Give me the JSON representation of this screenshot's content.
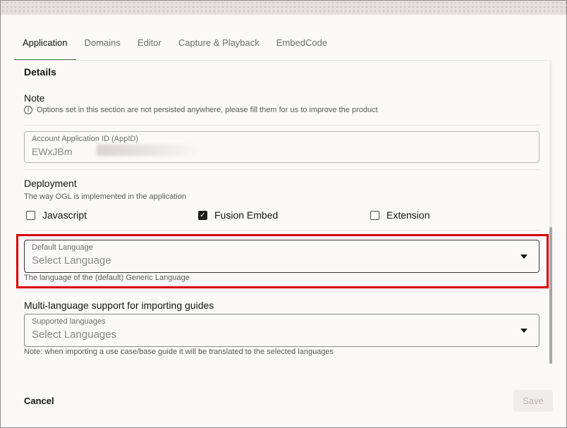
{
  "tabs": [
    {
      "label": "Application",
      "active": true
    },
    {
      "label": "Domains",
      "active": false
    },
    {
      "label": "Editor",
      "active": false
    },
    {
      "label": "Capture & Playback",
      "active": false
    },
    {
      "label": "EmbedCode",
      "active": false
    }
  ],
  "details": {
    "title": "Details",
    "note_title": "Note",
    "note_text": "Options set in this section are not persisted anywhere, please fill them for us to improve the product",
    "info_icon": "i"
  },
  "app_id": {
    "label": "Account Application ID (AppID)",
    "value": "EWxJBm"
  },
  "deployment": {
    "title": "Deployment",
    "subtitle": "The way OGL is implemented in the application",
    "options": [
      {
        "label": "Javascript",
        "checked": false
      },
      {
        "label": "Fusion Embed",
        "checked": true
      },
      {
        "label": "Extension",
        "checked": false
      }
    ],
    "check_mark": "✓"
  },
  "default_language": {
    "label": "Default Language",
    "placeholder": "Select Language",
    "help": "The language of the (default) Generic Language"
  },
  "multi_language": {
    "title": "Multi-language support for importing guides",
    "label": "Supported languages",
    "placeholder": "Select Languages",
    "help": "Note: when importing a use case/base guide it will be translated to the selected languages"
  },
  "footer": {
    "cancel_label": "Cancel",
    "save_label": "Save"
  },
  "colors": {
    "highlight": "#d50000",
    "active_tab_underline": "#3f7c3b"
  }
}
